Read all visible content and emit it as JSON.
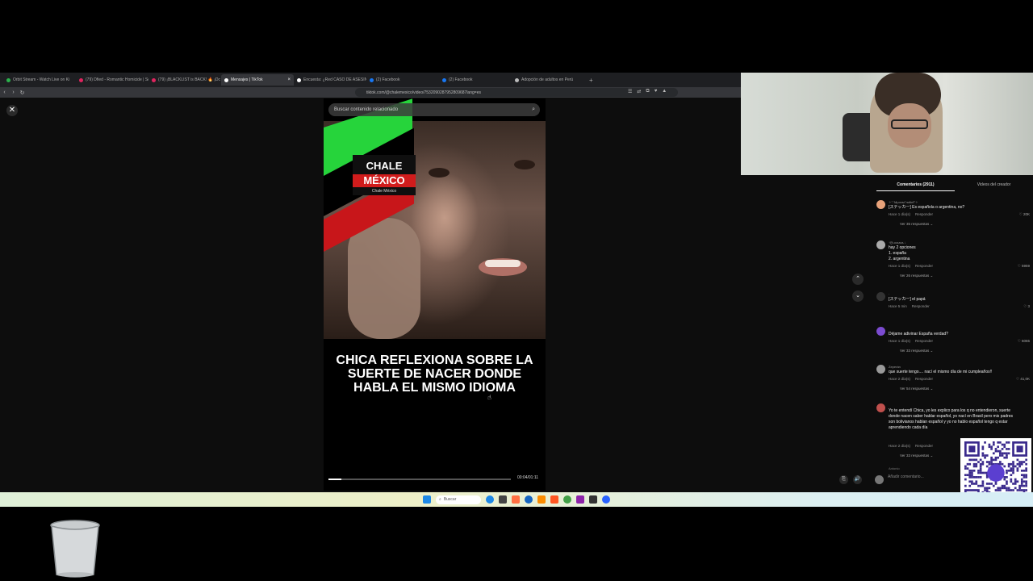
{
  "browser": {
    "tabs": [
      {
        "label": "Orbit Stream - Watch Live on Ki",
        "color": "#2bb24c",
        "active": false
      },
      {
        "label": "(79) Dfied - Romantic Homicide | Sol",
        "color": "#e0245e",
        "active": false
      },
      {
        "label": "(79) ¡BLACKLIST is BACK! 🔥 ¡Dc",
        "color": "#e0245e",
        "active": false
      },
      {
        "label": "Mensajes | TikTok",
        "color": "#ffffff",
        "active": true
      },
      {
        "label": "Encuesta: ¿Red CASO DE ASESINA?",
        "color": "#ffffff",
        "active": false
      },
      {
        "label": "(2) Facebook",
        "color": "#1877f2",
        "active": false
      },
      {
        "label": "(2) Facebook",
        "color": "#1877f2",
        "active": false
      },
      {
        "label": "Adopción de adultos en Perú",
        "color": "#bbbbbb",
        "active": false
      }
    ],
    "url": "tiktok.com/@chalemexico/video/7532090287952809687lang=es",
    "nav_back": "‹",
    "nav_forward": "›",
    "nav_reload": "↻",
    "new_tab": "+",
    "url_icons": [
      "☰",
      "⇄",
      "⧉",
      "♥",
      "▲"
    ]
  },
  "video": {
    "search_placeholder": "Buscar contenido relacionado",
    "logo_top": "CHALE",
    "logo_mid": "MÉXICO",
    "logo_sub": "Chale México",
    "caption": "CHICA REFLEXIONA SOBRE LA SUERTE DE NACER DONDE HABLA EL MISMO IDIOMA",
    "time": "00:04/01:11",
    "progress": 0.07
  },
  "page": {
    "close_icon": "✕"
  },
  "sidebar": {
    "tabs": [
      {
        "label": "Comentarios (2911)",
        "active": true
      },
      {
        "label": "Videos del creador",
        "active": false
      }
    ],
    "comments": [
      {
        "user": "✧♡Мμαчм°лαℓιєℓ°✧",
        "text": "[ステッカー] Es española o argentina, no?",
        "time": "Hace 1 día(s)",
        "reply": "Responder",
        "likes": "♡ 20K",
        "more": "Ver 35 respuestas ⌄",
        "avatar": "#e8a27a"
      },
      {
        "user": "↑ღʟᴜᴄɪᴀɴᴀ ↓",
        "text": "hay 2 opciones\n1. españa\n2. argentina",
        "time": "Hace 1 día(s)",
        "reply": "Responder",
        "likes": "♡ 5959",
        "more": "Ver 26 respuestas ⌄",
        "avatar": "#aaaaaa"
      },
      {
        "user": "·",
        "text": "[ステッカー] el papá",
        "time": "Hace 5 min",
        "reply": "Responder",
        "likes": "♡ 3",
        "more": "",
        "avatar": "#333333"
      },
      {
        "user": "",
        "text": "Déjame adivinar España verdad?",
        "time": "Hace 1 día(s)",
        "reply": "Responder",
        "likes": "♡ 6065",
        "more": "Ver 33 respuestas ⌄",
        "avatar": "#7b4bd0"
      },
      {
        "user": "Zeperán",
        "text": "que suerte tengo.... nací el mismo día de mi cumpleaños!!",
        "time": "Hace 2 día(s)",
        "reply": "Responder",
        "likes": "♡ 41,0K",
        "more": "Ver 54 respuestas ⌄",
        "avatar": "#9a9a9a"
      },
      {
        "user": "",
        "text": "Yo te entendí Chica, yo les explico para los q no entendieron, suerte donde nacen saber hablar español, yo nací en Brasil pero mis padres son bolivianos hablan español y yo no hablo español tengo q estar aprendiendo cada día",
        "time": "Hace 2 día(s)",
        "reply": "Responder",
        "likes": "",
        "more": "Ver 33 respuestas ⌄",
        "avatar": "#c0504d"
      }
    ],
    "partial_user": "Antonio",
    "input_placeholder": "Añadir comentario...",
    "arrow_up": "⌃",
    "arrow_down": "⌄",
    "ctrl_icons": [
      "⎘",
      "🔊"
    ]
  },
  "taskbar": {
    "search_label": "Buscar",
    "icon_colors": [
      "#1e88e5",
      "#444444",
      "#ff7043",
      "#1565c0",
      "#fb8c00",
      "#ff5722",
      "#43a047",
      "#8e24aa",
      "#333333",
      "#2962ff"
    ]
  },
  "colors": {
    "accent_green": "#26d43b",
    "accent_red": "#c8161a",
    "qr_accent": "#3a2a8c"
  }
}
